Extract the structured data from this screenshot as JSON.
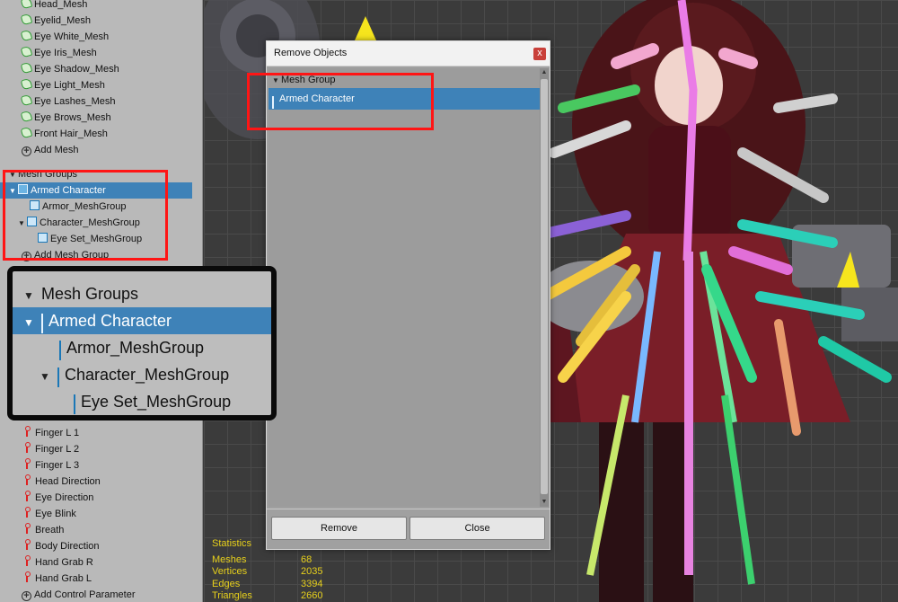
{
  "hierarchy": {
    "meshes": [
      "Head_Mesh",
      "Eyelid_Mesh",
      "Eye White_Mesh",
      "Eye Iris_Mesh",
      "Eye Shadow_Mesh",
      "Eye Light_Mesh",
      "Eye Lashes_Mesh",
      "Eye Brows_Mesh",
      "Front Hair_Mesh"
    ],
    "add_mesh_label": "Add Mesh",
    "mesh_groups_header": "Mesh Groups",
    "mesh_groups": [
      {
        "label": "Armed Character",
        "level": 0,
        "expanded": true,
        "selected": true
      },
      {
        "label": "Armor_MeshGroup",
        "level": 1
      },
      {
        "label": "Character_MeshGroup",
        "level": 1,
        "expanded": true
      },
      {
        "label": "Eye Set_MeshGroup",
        "level": 2
      }
    ],
    "add_mesh_group_label": "Add Mesh Group",
    "control_params": [
      "Finger L 1",
      "Finger L 2",
      "Finger L 3",
      "Head Direction",
      "Eye Direction",
      "Eye Blink",
      "Breath",
      "Body Direction",
      "Hand Grab R",
      "Hand Grab L"
    ],
    "add_control_param_label": "Add Control Parameter"
  },
  "zoom_callout": {
    "header": "Mesh Groups",
    "items": [
      "Armed Character",
      "Armor_MeshGroup",
      "Character_MeshGroup",
      "Eye Set_MeshGroup"
    ]
  },
  "dialog": {
    "title": "Remove Objects",
    "close_glyph": "x",
    "section": "Mesh Group",
    "selected_item": "Armed Character",
    "remove_label": "Remove",
    "close_label": "Close"
  },
  "statistics": {
    "title": "Statistics",
    "rows": [
      {
        "label": "Meshes",
        "value": "68"
      },
      {
        "label": "Vertices",
        "value": "2035"
      },
      {
        "label": "Edges",
        "value": "3394"
      },
      {
        "label": "Triangles",
        "value": "2660"
      }
    ]
  },
  "colors": {
    "selection": "#3e82b8",
    "highlight_red": "#ff1515",
    "stats_yellow": "#e7d01b"
  }
}
